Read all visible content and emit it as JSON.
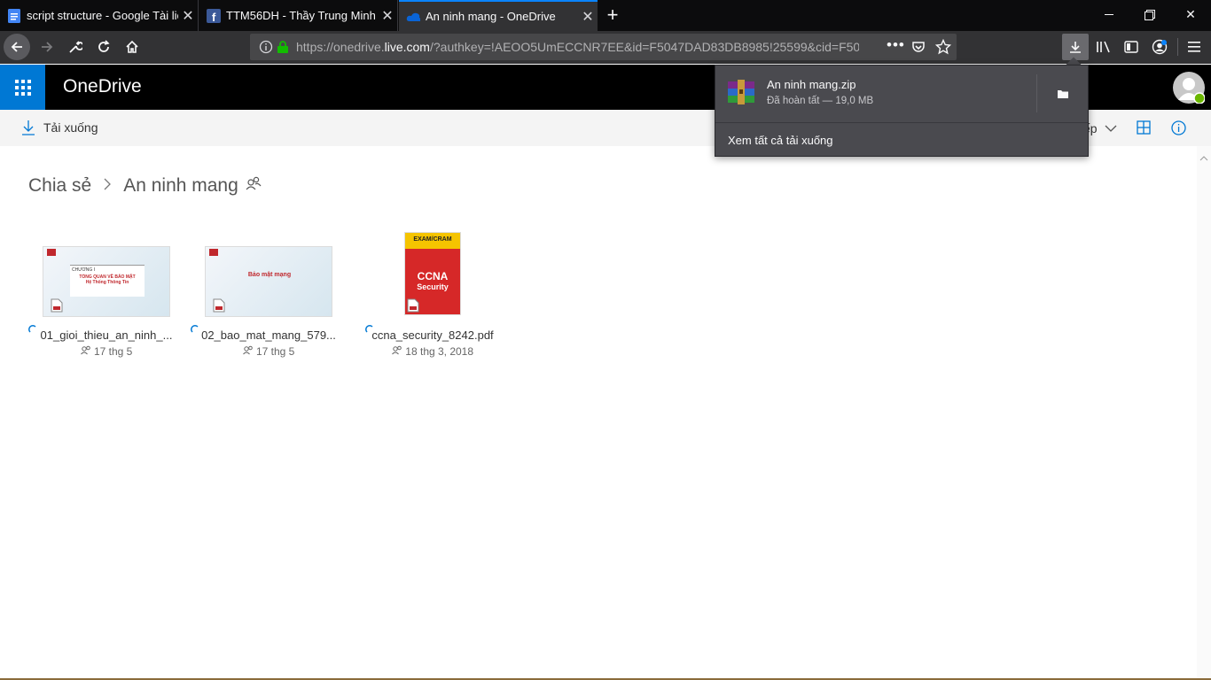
{
  "tabs": [
    {
      "label": "script structure - Google Tài liệu",
      "icon": "google-docs-icon",
      "active": false
    },
    {
      "label": "TTM56DH - Thầy Trung Minh",
      "icon": "facebook-icon",
      "active": false
    },
    {
      "label": "An ninh mang - OneDrive",
      "icon": "onedrive-icon",
      "active": true
    }
  ],
  "url": {
    "prefix": "https://onedrive.",
    "domain": "live.com",
    "rest": "/?authkey=!AEOO5UmECCNR7EE&id=F5047DAD83DB8985!25599&cid=F50..."
  },
  "app": {
    "name": "OneDrive"
  },
  "commands": {
    "download_label": "Tải xuống",
    "sort_partial": "ếp"
  },
  "breadcrumb": {
    "parent": "Chia sẻ",
    "current": "An ninh mang"
  },
  "files": [
    {
      "name": "01_gioi_thieu_an_ninh_...",
      "date": "17 thg 5",
      "thumb_lines": [
        "CHƯƠNG I",
        "TỔNG QUAN VỀ BẢO MẬT",
        "Hệ Thống Thông Tin"
      ]
    },
    {
      "name": "02_bao_mat_mang_579...",
      "date": "17 thg 5",
      "thumb_lines": [
        "Bảo mật mạng"
      ]
    },
    {
      "name": "ccna_security_8242.pdf",
      "date": "18 thg 3, 2018",
      "thumb_lines": [
        "EXAM/CRAM",
        "CCNA",
        "Security"
      ]
    }
  ],
  "download_panel": {
    "filename": "An ninh mang.zip",
    "status": "Đã hoàn tất — 19,0 MB",
    "show_all": "Xem tất cả tải xuống"
  },
  "colors": {
    "accent": "#0a84ff",
    "onedrive_blue": "#0078d4",
    "thumb_red": "#c0282d"
  }
}
